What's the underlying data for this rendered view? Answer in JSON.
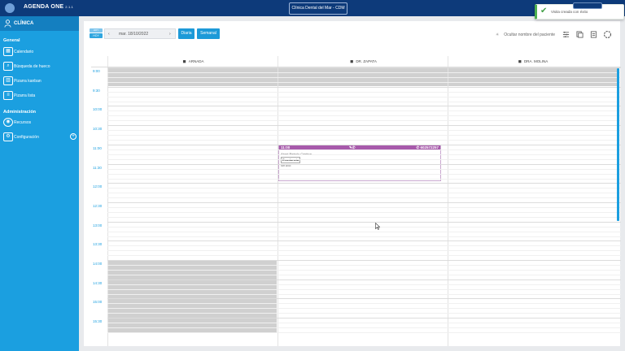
{
  "topbar": {
    "app_name": "AGENDA ONE",
    "version": "2.1.1",
    "clinic": "Clínica Dental del Mar - CDM"
  },
  "toast": {
    "message": "Visita creada con éxito"
  },
  "sidebar": {
    "header": "CLÍNICA",
    "sections": [
      {
        "title": "General",
        "items": [
          {
            "label": "Calendario",
            "icon": "calendar-icon"
          },
          {
            "label": "Búsqueda de hueco",
            "icon": "search-slot-icon"
          },
          {
            "label": "Pizarra kanban",
            "icon": "kanban-icon"
          },
          {
            "label": "Pizarra lista",
            "icon": "list-board-icon"
          }
        ]
      },
      {
        "title": "Administración",
        "items": [
          {
            "label": "Recursos",
            "icon": "resources-icon"
          },
          {
            "label": "Configuración",
            "icon": "settings-icon"
          }
        ]
      }
    ]
  },
  "toolbar": {
    "today_top": "HOY",
    "today_bottom": "HOY",
    "date": "mar. 18/10/2022",
    "prev": "‹",
    "next": "›",
    "btn_daily": "Diaria",
    "btn_weekly": "Semanal",
    "hide_patient": "Ocultar nombre del paciente"
  },
  "calendar": {
    "columns": [
      "ARNADA",
      "DR. ZAPATA",
      "DRA. MOLINA"
    ],
    "times": [
      "9:00",
      "9:30",
      "10:00",
      "10:30",
      "11:00",
      "11:30",
      "12:00",
      "12:30",
      "13:00",
      "13:30",
      "14:00",
      "14:30",
      "15:00",
      "15:30"
    ],
    "appointment": {
      "time": "11:00",
      "phone": "602572257",
      "patient": "Abad Rebolo Cristina",
      "type": "Exodoncia",
      "insurance": "Sin ASE"
    }
  },
  "colors": {
    "sidebar": "#1b9fe0",
    "topbar": "#0d3a7a",
    "accent": "#1d9ad8",
    "appointment": "#a75aab",
    "blocked": "#d0d0d0"
  }
}
